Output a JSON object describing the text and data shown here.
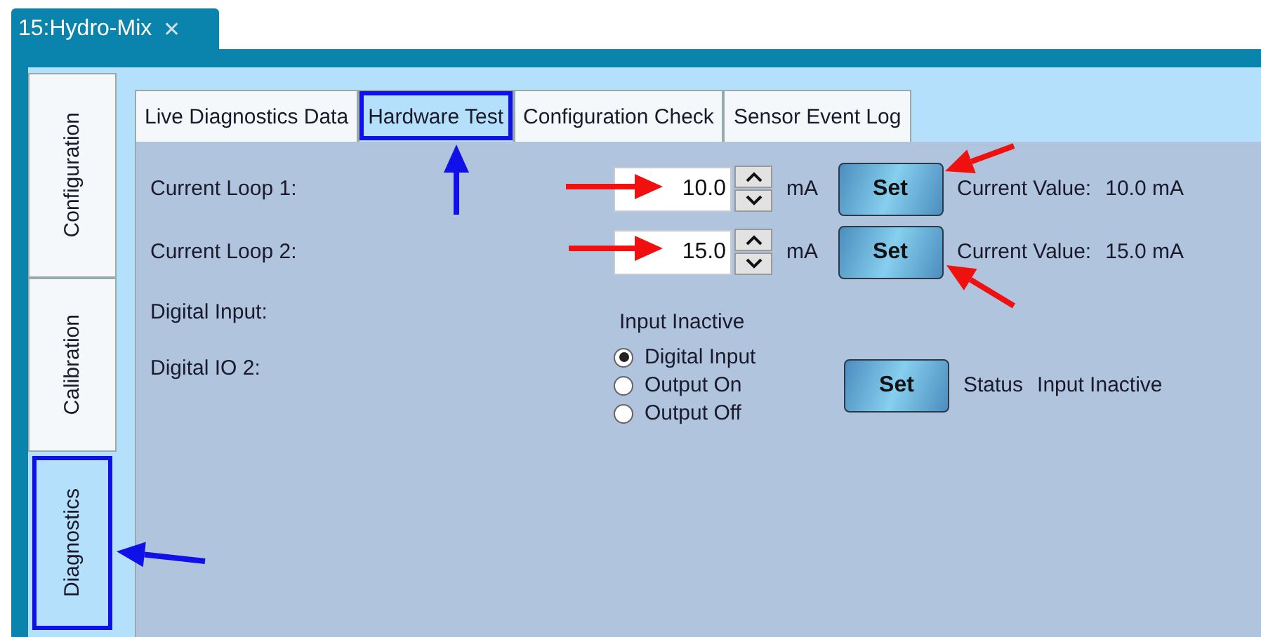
{
  "document_tab": {
    "title": "15:Hydro-Mix",
    "close": "✕"
  },
  "side_tabs": [
    {
      "label": "Configuration",
      "selected": false,
      "highlighted": false
    },
    {
      "label": "Calibration",
      "selected": false,
      "highlighted": false
    },
    {
      "label": "Diagnostics",
      "selected": true,
      "highlighted": true
    }
  ],
  "tabs": [
    {
      "label": "Live Diagnostics Data",
      "selected": false,
      "highlighted": false
    },
    {
      "label": "Hardware Test",
      "selected": true,
      "highlighted": true
    },
    {
      "label": "Configuration Check",
      "selected": false,
      "highlighted": false
    },
    {
      "label": "Sensor Event Log",
      "selected": false,
      "highlighted": false
    }
  ],
  "current_loops": [
    {
      "label": "Current Loop 1:",
      "value": "10.0",
      "unit": "mA",
      "button": "Set",
      "current_value_label": "Current Value:",
      "current_value": "10.0 mA",
      "pointed_out": true
    },
    {
      "label": "Current Loop 2:",
      "value": "15.0",
      "unit": "mA",
      "button": "Set",
      "current_value_label": "Current Value:",
      "current_value": "15.0 mA",
      "pointed_out": true
    }
  ],
  "digital_input": {
    "label": "Digital Input:",
    "state": "Input Inactive"
  },
  "digital_io": {
    "label": "Digital IO 2:",
    "options": [
      {
        "label": "Digital Input",
        "selected": true
      },
      {
        "label": "Output On",
        "selected": false
      },
      {
        "label": "Output Off",
        "selected": false
      }
    ],
    "button": "Set",
    "status_label": "Status",
    "status": "Input Inactive"
  }
}
